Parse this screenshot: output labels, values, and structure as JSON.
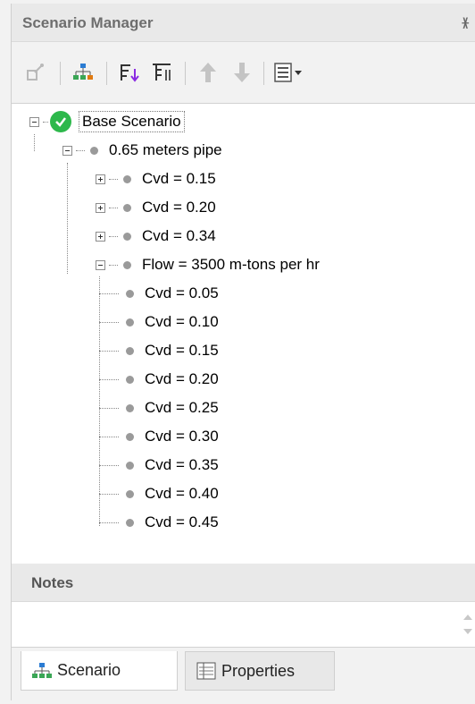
{
  "panel": {
    "title": "Scenario Manager",
    "pin_glyph": "ᚕ"
  },
  "toolbar": {
    "buttons": [
      "new-scenario-icon",
      "scenario-tree-icon",
      "sort-ascending-icon",
      "sort-descending-icon",
      "move-up-icon",
      "move-down-icon",
      "view-options-icon"
    ]
  },
  "tree": {
    "root": {
      "label": "Base Scenario",
      "status": "active-check"
    },
    "child": {
      "label": "0.65 meters pipe"
    },
    "collapsed": [
      "Cvd = 0.15",
      "Cvd = 0.20",
      "Cvd = 0.34"
    ],
    "expanded": {
      "label": "Flow = 3500 m-tons per hr"
    },
    "leaves": [
      "Cvd = 0.05",
      "Cvd = 0.10",
      "Cvd = 0.15",
      "Cvd = 0.20",
      "Cvd = 0.25",
      "Cvd = 0.30",
      "Cvd = 0.35",
      "Cvd = 0.40",
      "Cvd = 0.45"
    ]
  },
  "notes": {
    "title": "Notes",
    "text": ""
  },
  "tabs": [
    {
      "label": "Scenario",
      "active": true
    },
    {
      "label": "Properties",
      "active": false
    }
  ],
  "colors": {
    "accent_green": "#2db84b",
    "bullet_gray": "#9a9a9a",
    "header_bg": "#e9e9e9"
  }
}
